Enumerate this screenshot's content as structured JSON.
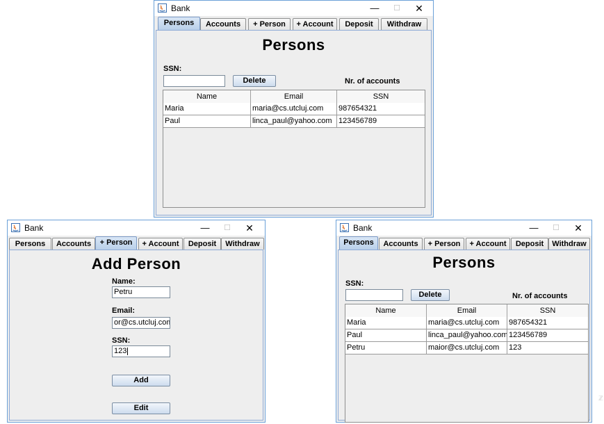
{
  "window_title": "Bank",
  "controls": {
    "minimize": "—",
    "maximize": "☐",
    "close": "✕"
  },
  "tabs": [
    "Persons",
    "Accounts",
    "+ Person",
    "+ Account",
    "Deposit",
    "Withdraw"
  ],
  "persons_view": {
    "heading": "Persons",
    "ssn_label": "SSN:",
    "ssn_value": "",
    "delete_button": "Delete",
    "accounts_label": "Nr. of accounts",
    "columns": [
      "Name",
      "Email",
      "SSN"
    ]
  },
  "window_top": {
    "active_tab": "Persons",
    "rows": [
      {
        "name": "Maria",
        "email": "maria@cs.utcluj.com",
        "ssn": "987654321"
      },
      {
        "name": "Paul",
        "email": "linca_paul@yahoo.com",
        "ssn": "123456789"
      }
    ]
  },
  "window_left": {
    "active_tab": "+ Person",
    "heading": "Add Person",
    "name_label": "Name:",
    "name_value": "Petru",
    "email_label": "Email:",
    "email_value": "or@cs.utcluj.com",
    "ssn_label": "SSN:",
    "ssn_value": "123",
    "add_button": "Add",
    "edit_button": "Edit"
  },
  "window_right": {
    "active_tab": "Persons",
    "rows": [
      {
        "name": "Maria",
        "email": "maria@cs.utcluj.com",
        "ssn": "987654321"
      },
      {
        "name": "Paul",
        "email": "linca_paul@yahoo.com",
        "ssn": "123456789"
      },
      {
        "name": "Petru",
        "email": "maior@cs.utcluj.com",
        "ssn": "123"
      }
    ]
  },
  "edge_glyph": "ℤ"
}
